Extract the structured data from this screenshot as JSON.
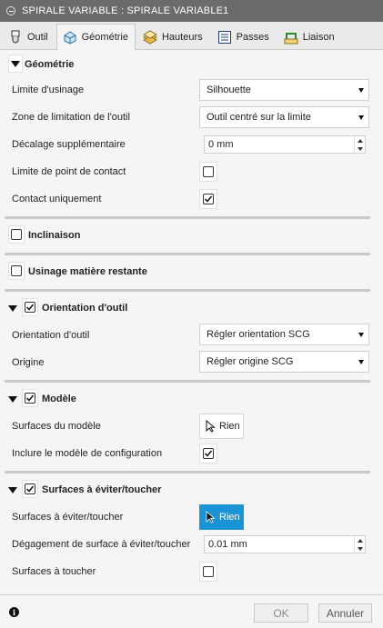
{
  "window": {
    "title": "SPIRALE VARIABLE : SPIRALE VARIABLE1"
  },
  "tabs": [
    {
      "label": "Outil",
      "icon": "tool-icon"
    },
    {
      "label": "Géométrie",
      "icon": "geometry-icon",
      "active": true
    },
    {
      "label": "Hauteurs",
      "icon": "heights-icon"
    },
    {
      "label": "Passes",
      "icon": "passes-icon"
    },
    {
      "label": "Liaison",
      "icon": "linking-icon"
    }
  ],
  "geometrie": {
    "title": "Géométrie",
    "limite_usinage": {
      "label": "Limite d'usinage",
      "value": "Silhouette"
    },
    "zone_limitation": {
      "label": "Zone de limitation de l'outil",
      "value": "Outil centré sur la limite"
    },
    "decalage": {
      "label": "Décalage supplémentaire",
      "value": "0 mm"
    },
    "limite_point_contact": {
      "label": "Limite de point de contact",
      "checked": false
    },
    "contact_uniquement": {
      "label": "Contact uniquement",
      "checked": true
    }
  },
  "inclinaison": {
    "title": "Inclinaison",
    "checked": false
  },
  "matiere_restante": {
    "title": "Usinage matière restante",
    "checked": false
  },
  "orientation": {
    "title": "Orientation d'outil",
    "checked": true,
    "orientation": {
      "label": "Orientation d'outil",
      "value": "Régler orientation SCG"
    },
    "origine": {
      "label": "Origine",
      "value": "Régler origine SCG"
    }
  },
  "modele": {
    "title": "Modèle",
    "checked": true,
    "surfaces": {
      "label": "Surfaces du modèle",
      "value": "Rien"
    },
    "inclure": {
      "label": "Inclure le modèle de configuration",
      "checked": true
    }
  },
  "eviter": {
    "title": "Surfaces à éviter/toucher",
    "checked": true,
    "surfaces": {
      "label": "Surfaces à éviter/toucher",
      "value": "Rien"
    },
    "degagement": {
      "label": "Dégagement de surface à éviter/toucher",
      "value": "0.01 mm"
    },
    "toucher": {
      "label": "Surfaces à toucher",
      "checked": false
    }
  },
  "footer": {
    "ok": "OK",
    "cancel": "Annuler"
  },
  "colors": {
    "accent": "#1a94d6",
    "titlebar": "#6b6b6b"
  }
}
